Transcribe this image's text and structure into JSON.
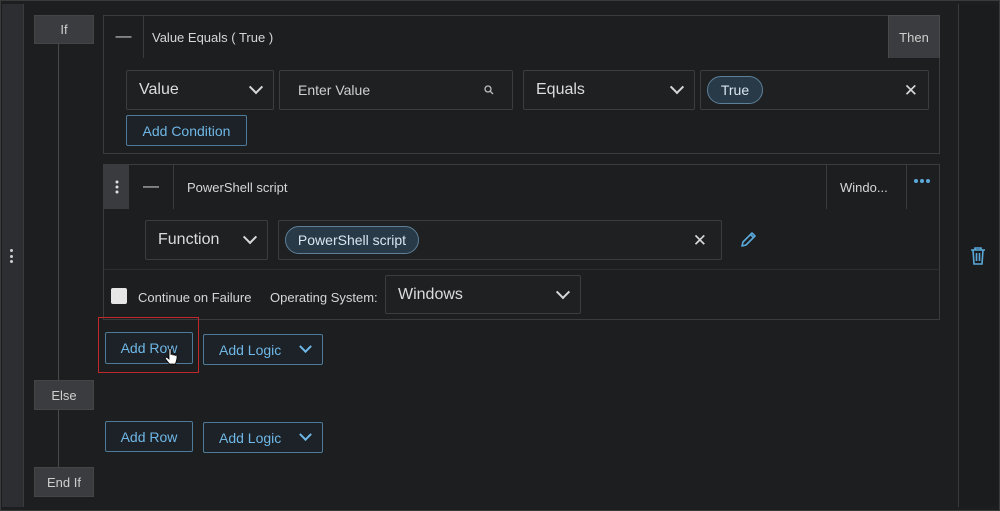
{
  "blocks": {
    "if_label": "If",
    "then_label": "Then",
    "else_label": "Else",
    "endif_label": "End If"
  },
  "condition": {
    "title": "Value Equals ( True )",
    "value_select": "Value",
    "value_placeholder": "Enter Value",
    "operator_select": "Equals",
    "true_chip": "True",
    "add_condition_label": "Add Condition"
  },
  "action": {
    "title": "PowerShell script",
    "target_truncated": "Windo...",
    "function_select": "Function",
    "function_chip": "PowerShell script",
    "continue_on_failure_label": "Continue on Failure",
    "os_label": "Operating System:",
    "os_select": "Windows"
  },
  "then_buttons": {
    "add_row": "Add Row",
    "add_logic": "Add Logic"
  },
  "else_buttons": {
    "add_row": "Add Row",
    "add_logic": "Add Logic"
  },
  "icons": {
    "drag": "vertical-dots-icon",
    "collapse": "minus-icon",
    "search": "search-icon",
    "clear": "close-icon",
    "edit": "pencil-icon",
    "more": "more-horizontal-icon",
    "delete": "trash-icon",
    "dropdown": "chevron-down-icon"
  },
  "colors": {
    "accent": "#6fb7e6",
    "highlight_box": "#c0282c"
  }
}
